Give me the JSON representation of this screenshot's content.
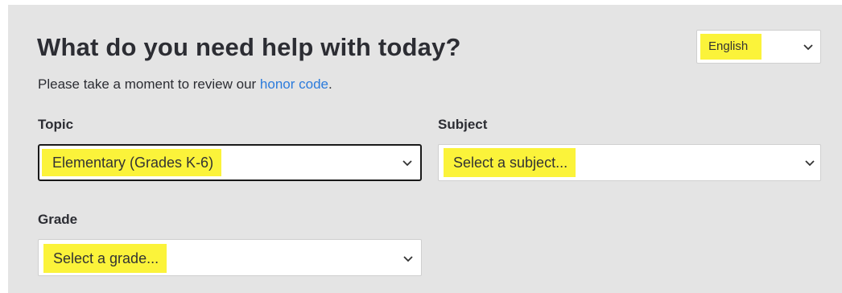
{
  "header": {
    "title": "What do you need help with today?"
  },
  "intro": {
    "text_before": "Please take a moment to review our ",
    "link_text": "honor code",
    "text_after": "."
  },
  "language": {
    "selected": "English"
  },
  "form": {
    "topic": {
      "label": "Topic",
      "selected": "Elementary (Grades K-6)"
    },
    "subject": {
      "label": "Subject",
      "placeholder": "Select a subject..."
    },
    "grade": {
      "label": "Grade",
      "placeholder": "Select a grade..."
    }
  },
  "icons": {
    "dropdown": "chevron-down-icon"
  },
  "colors": {
    "panel_background": "#e4e4e4",
    "highlight": "#fbf33a",
    "link": "#2b7bdc",
    "text": "#2c2d33"
  }
}
